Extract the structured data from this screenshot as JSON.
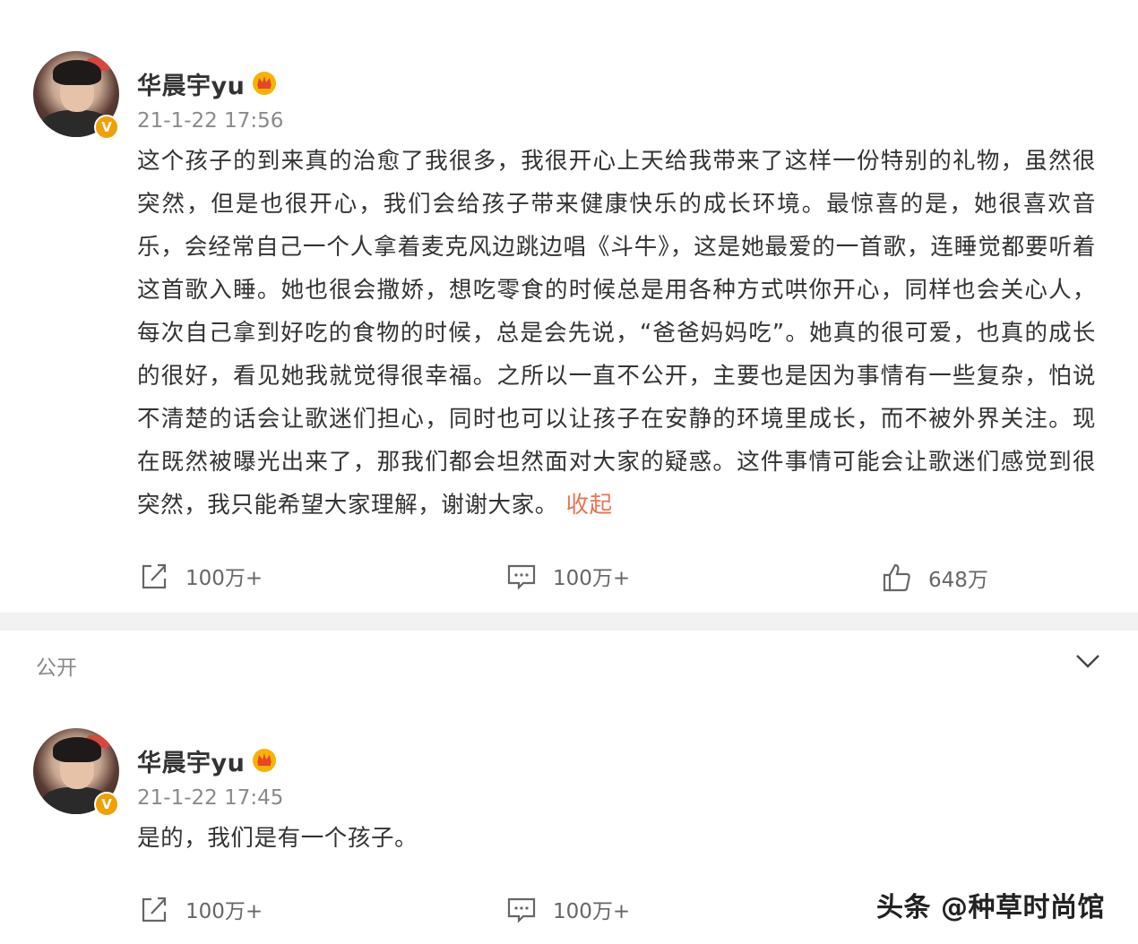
{
  "post1": {
    "username": "华晨宇yu",
    "timestamp": "21-1-22 17:56",
    "text": "这个孩子的到来真的治愈了我很多，我很开心上天给我带来了这样一份特别的礼物，虽然很突然，但是也很开心，我们会给孩子带来健康快乐的成长环境。最惊喜的是，她很喜欢音乐，会经常自己一个人拿着麦克风边跳边唱《斗牛》，这是她最爱的一首歌，连睡觉都要听着这首歌入睡。她也很会撒娇，想吃零食的时候总是用各种方式哄你开心，同样也会关心人，每次自己拿到好吃的食物的时候，总是会先说，“爸爸妈妈吃”。她真的很可爱，也真的成长的很好，看见她我就觉得很幸福。之所以一直不公开，主要也是因为事情有一些复杂，怕说不清楚的话会让歌迷们担心，同时也可以让孩子在安静的环境里成长，而不被外界关注。现在既然被曝光出来了，那我们都会坦然面对大家的疑惑。这件事情可能会让歌迷们感觉到很突然，我只能希望大家理解，谢谢大家。",
    "collapse_label": "收起",
    "repost_count": "100万+",
    "comment_count": "100万+",
    "like_count": "648万"
  },
  "section": {
    "label": "公开"
  },
  "post2": {
    "username": "华晨宇yu",
    "timestamp": "21-1-22 17:45",
    "text": "是的，我们是有一个孩子。",
    "repost_count": "100万+",
    "comment_count": "100万+"
  },
  "watermark": "头条 @种草时尚馆",
  "colors": {
    "accent": "#eb7350",
    "verified": "#f0a000",
    "separator": "#f2f2f2"
  }
}
